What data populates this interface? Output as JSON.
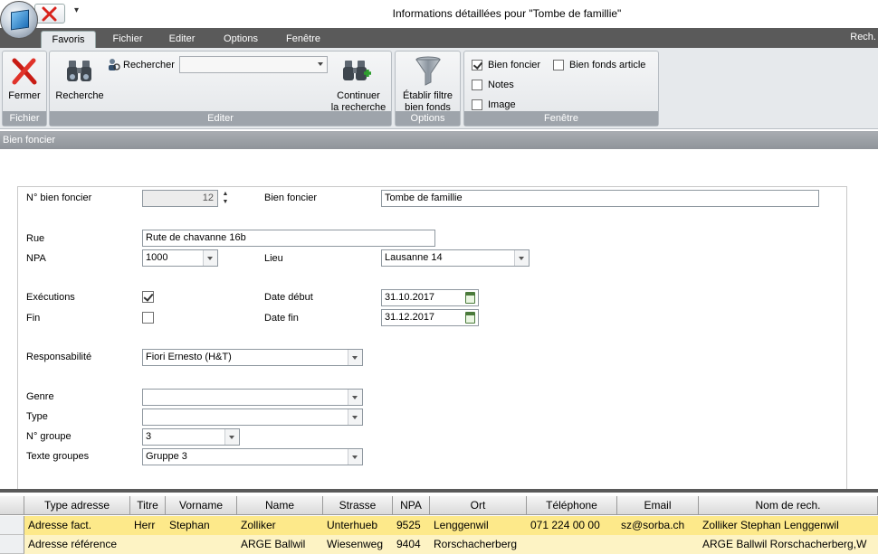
{
  "window": {
    "title": "Informations détaillées pour \"Tombe de famillie\"",
    "qat_menu_glyph": "▾"
  },
  "tabs": [
    {
      "label": "Favoris",
      "active": true
    },
    {
      "label": "Fichier"
    },
    {
      "label": "Editer"
    },
    {
      "label": "Options"
    },
    {
      "label": "Fenêtre"
    }
  ],
  "tabbar_right": "Rech.",
  "ribbon": {
    "fichier": {
      "group_label": "Fichier",
      "close_label": "Fermer"
    },
    "editer": {
      "group_label": "Editer",
      "search_label": "Recherche",
      "rechercher_label": "Rechercher",
      "rechercher_value": "",
      "continue_label_1": "Continuer",
      "continue_label_2": "la recherche"
    },
    "options": {
      "group_label": "Options",
      "filter_label_1": "Établir filtre",
      "filter_label_2": "bien fonds"
    },
    "fenetre": {
      "group_label": "Fenêtre",
      "bien_foncier": "Bien foncier",
      "bien_fonds_article": "Bien fonds article",
      "notes": "Notes",
      "image": "Image"
    }
  },
  "section": {
    "title": "Bien foncier"
  },
  "form": {
    "no_bien_foncier_label": "N° bien foncier",
    "no_bien_foncier_value": "12",
    "bien_foncier_label": "Bien foncier",
    "bien_foncier_value": "Tombe de famillie",
    "rue_label": "Rue",
    "rue_value": "Rute de chavanne 16b",
    "npa_label": "NPA",
    "npa_value": "1000",
    "lieu_label": "Lieu",
    "lieu_value": "Lausanne 14",
    "executions_label": "Exécutions",
    "fin_label": "Fin",
    "date_debut_label": "Date début",
    "date_debut_value": "31.10.2017",
    "date_fin_label": "Date fin",
    "date_fin_value": "31.12.2017",
    "responsabilite_label": "Responsabilité",
    "responsabilite_value": "Fiori Ernesto (H&T)",
    "genre_label": "Genre",
    "genre_value": "",
    "type_label": "Type",
    "type_value": "",
    "no_groupe_label": "N° groupe",
    "no_groupe_value": "3",
    "texte_groupes_label": "Texte groupes",
    "texte_groupes_value": "Gruppe 3"
  },
  "grid": {
    "columns": [
      "Type adresse",
      "Titre",
      "Vorname",
      "Name",
      "Strasse",
      "NPA",
      "Ort",
      "Téléphone",
      "Email",
      "Nom de rech."
    ],
    "rows": [
      [
        "Adresse fact.",
        "Herr",
        "Stephan",
        "Zolliker",
        "Unterhueb",
        "9525",
        "Lenggenwil",
        "071 224 00 00",
        "sz@sorba.ch",
        "Zolliker Stephan Lenggenwil"
      ],
      [
        "Adresse référence",
        "",
        "",
        "ARGE Ballwil",
        "Wiesenweg",
        "9404",
        "Rorschacherberg",
        "",
        "",
        "ARGE Ballwil Rorschacherberg,W"
      ]
    ],
    "selected_row_color": "#fde98a",
    "row_color": "#fdf3c4"
  },
  "colors": {
    "accent_dark": "#5a5a5a",
    "ribbon_bg": "#e6e9ec",
    "close_red": "#d8231c"
  }
}
